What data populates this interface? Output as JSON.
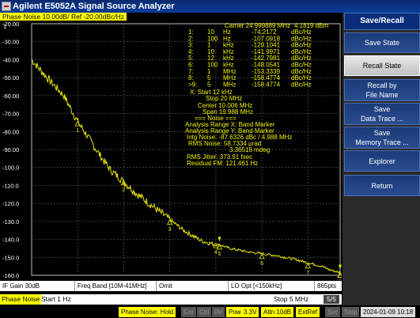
{
  "window": {
    "title": "Agilent E5052A Signal Source Analyzer"
  },
  "trace_header": {
    "label": "Phase Noise 10.00dB/ Ref -20.00dBc/Hz"
  },
  "trace_number": "1",
  "chart_data": {
    "type": "line",
    "xscale": "log",
    "xlim_hz": [
      1,
      5000000
    ],
    "ylim": [
      -160,
      -20
    ],
    "ylabel_unit": "dBc/Hz",
    "y_ticks": [
      "-20.00",
      "-30.00",
      "-40.00",
      "-50.00",
      "-60.00",
      "-70.00",
      "-80.00",
      "-90.00",
      "-100.0",
      "-110.0",
      "-120.0",
      "-130.0",
      "-140.0",
      "-150.0",
      "-160.0"
    ],
    "trace_color": "#e8e800",
    "grid": true,
    "points_hz_dbc": [
      [
        1,
        -40
      ],
      [
        2,
        -49
      ],
      [
        5,
        -60
      ],
      [
        10,
        -74.5
      ],
      [
        20,
        -86
      ],
      [
        30,
        -93
      ],
      [
        50,
        -101
      ],
      [
        100,
        -108
      ],
      [
        200,
        -115
      ],
      [
        500,
        -123
      ],
      [
        1000,
        -129
      ],
      [
        2000,
        -135
      ],
      [
        5000,
        -141
      ],
      [
        10000,
        -143
      ],
      [
        12000,
        -143
      ],
      [
        20000,
        -145
      ],
      [
        50000,
        -147
      ],
      [
        100000,
        -148
      ],
      [
        200000,
        -149
      ],
      [
        500000,
        -151
      ],
      [
        1000000,
        -153
      ],
      [
        2000000,
        -155
      ],
      [
        3000000,
        -157
      ],
      [
        5000000,
        -158.5
      ]
    ],
    "markers": [
      {
        "label": "1",
        "freq_hz": 10,
        "value": -74.2172
      },
      {
        "label": "2",
        "freq_hz": 100,
        "value": -107.0918
      },
      {
        "label": "3",
        "freq_hz": 1000,
        "value": -129.1041
      },
      {
        "label": "4",
        "freq_hz": 10000,
        "value": -141.9971
      },
      {
        "label": "5",
        "freq_hz": 12000,
        "value": -142.7981
      },
      {
        "label": "6",
        "freq_hz": 100000,
        "value": -148.0541
      },
      {
        "label": "7",
        "freq_hz": 1000000,
        "value": -153.3339
      },
      {
        "label": "8",
        "freq_hz": 5000000,
        "value": -158.4774
      },
      {
        "label": ">9",
        "freq_hz": 5000000,
        "value": -158.4774
      }
    ],
    "band_markers_hz": [
      12000,
      20000000
    ]
  },
  "annotation": {
    "carrier_line": "Carrier 24.999889 MHz",
    "carrier_level": "4.1819 dBm",
    "marker_rows": [
      {
        "idx": "1:",
        "freq": "10",
        "unit": "Hz",
        "val": "-74.2172",
        "vunit": "dBc/Hz"
      },
      {
        "idx": "2:",
        "freq": "100",
        "unit": "Hz",
        "val": "-107.0918",
        "vunit": "dBc/Hz"
      },
      {
        "idx": "3:",
        "freq": "1",
        "unit": "kHz",
        "val": "-129.1041",
        "vunit": "dBc/Hz"
      },
      {
        "idx": "4:",
        "freq": "10",
        "unit": "kHz",
        "val": "-141.9971",
        "vunit": "dBc/Hz"
      },
      {
        "idx": "5:",
        "freq": "12",
        "unit": "kHz",
        "val": "-142.7981",
        "vunit": "dBc/Hz"
      },
      {
        "idx": "6:",
        "freq": "100",
        "unit": "kHz",
        "val": "-148.0541",
        "vunit": "dBc/Hz"
      },
      {
        "idx": "7:",
        "freq": "1",
        "unit": "MHz",
        "val": "-153.3339",
        "vunit": "dBc/Hz"
      },
      {
        "idx": "8:",
        "freq": "5",
        "unit": "MHz",
        "val": "-158.4774",
        "vunit": "dBc/Hz"
      },
      {
        "idx": ">9:",
        "freq": "5",
        "unit": "MHz",
        "val": "-158.4774",
        "vunit": "dBc/Hz"
      }
    ],
    "x_start": "X: Start 12 kHz",
    "x_stop": "Stop 20 MHz",
    "center": "Center 10.006 MHz",
    "span": "Span 19.988 MHz",
    "noise_header": "=== Noise ===",
    "range_x": "Analysis Range X: Band Marker",
    "range_y": "Analysis Range Y: Band Marker",
    "intg_noise": "Intg Noise: -87.6326 dBc / 4.988 MHz",
    "rms_noise_1": "RMS Noise: 58.7334 µrad",
    "rms_noise_2": "3.36518 mdeg",
    "rms_jitter": "RMS Jitter: 373.91 fsec",
    "residual_fm": "Residual FM: 121.461 Hz"
  },
  "status": {
    "if_gain": "IF Gain 30dB",
    "freq_band": "Freq Band [10M-41MHz]",
    "omit": "Omit",
    "lo_opt": "LO Opt [<150kHz]",
    "points": "865pts"
  },
  "bottom": {
    "mode": "Phase Noise",
    "start": "Start 1 Hz",
    "stop": "Stop 5 MHz",
    "range": "5/5"
  },
  "info": {
    "meas": "Phase Noise: Hold",
    "cor": "Cor",
    "ctrl": "Ctrl",
    "ov": "0V",
    "pow": "Pow",
    "pow_val": "3.3V",
    "attn": "Attn 10dB",
    "extref": "ExtRef",
    "svc": "Svc",
    "stop": "Stop",
    "datetime": "2024-01-09 10:18"
  },
  "softkeys": [
    {
      "label": "Save/Recall",
      "lines": [
        "Save/Recall"
      ]
    },
    {
      "label": "Save State",
      "lines": [
        "Save State"
      ]
    },
    {
      "label": "Recall State",
      "lines": [
        "Recall State"
      ]
    },
    {
      "label": "Recall by File Name",
      "lines": [
        "Recall by",
        "File Name"
      ]
    },
    {
      "label": "Save Data Trace ...",
      "lines": [
        "Save",
        "Data Trace ..."
      ]
    },
    {
      "label": "Save Memory Trace ...",
      "lines": [
        "Save",
        "Memory Trace ..."
      ]
    },
    {
      "label": "Explorer",
      "lines": [
        "Explorer"
      ]
    },
    {
      "label": "Return",
      "lines": [
        "Return"
      ]
    }
  ]
}
